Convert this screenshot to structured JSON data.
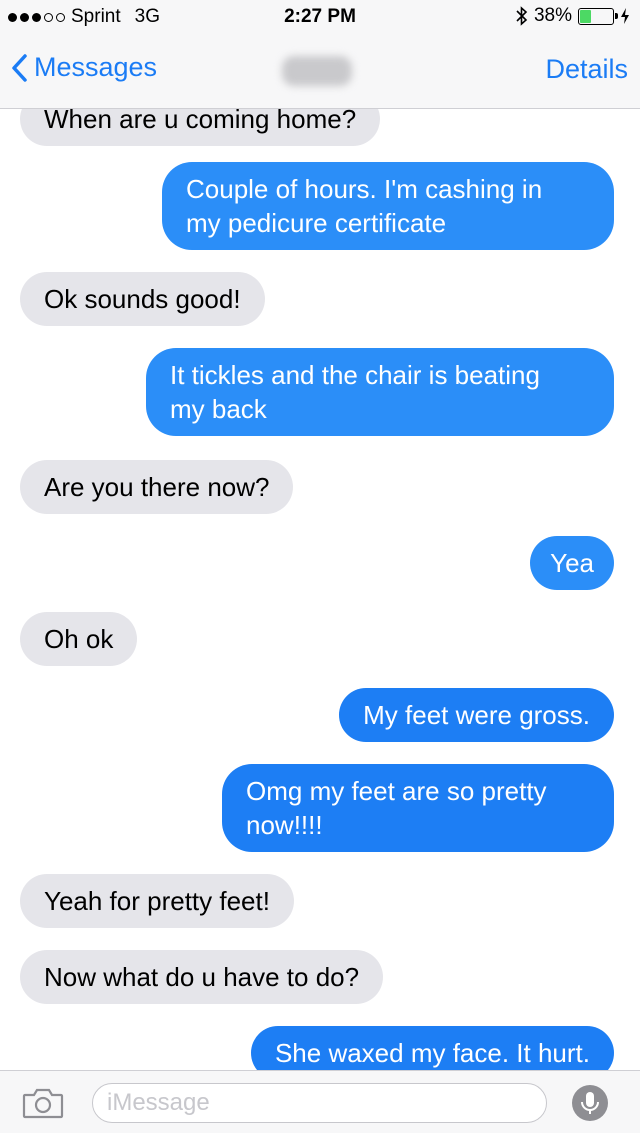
{
  "status": {
    "carrier": "Sprint",
    "network": "3G",
    "time": "2:27 PM",
    "battery_percent": "38%",
    "battery_level": 0.38
  },
  "nav": {
    "back_label": "Messages",
    "details_label": "Details"
  },
  "messages": [
    {
      "text": "When are u coming home?",
      "from": "them"
    },
    {
      "text": "Couple of hours. I'm cashing in",
      "text2": "my pedicure certificate",
      "from": "me"
    },
    {
      "text": "Ok sounds good!",
      "from": "them"
    },
    {
      "text": "It tickles and the chair is beating",
      "text2": "my back",
      "from": "me"
    },
    {
      "text": "Are you there now?",
      "from": "them"
    },
    {
      "text": "Yea",
      "from": "me"
    },
    {
      "text": "Oh ok",
      "from": "them"
    },
    {
      "text": "My feet were gross.",
      "from": "me"
    },
    {
      "text": "Omg my feet are so pretty",
      "text2": "now!!!!",
      "from": "me"
    },
    {
      "text": "Yeah for pretty feet!",
      "from": "them"
    },
    {
      "text": "Now what do u have to do?",
      "from": "them"
    },
    {
      "text": "She waxed my face. It hurt.",
      "from": "me"
    }
  ],
  "input": {
    "placeholder": "iMessage"
  },
  "colors": {
    "accent": "#1b7cf5",
    "outgoing_bubble": "#2b8ef8",
    "incoming_bubble": "#e5e5ea"
  }
}
